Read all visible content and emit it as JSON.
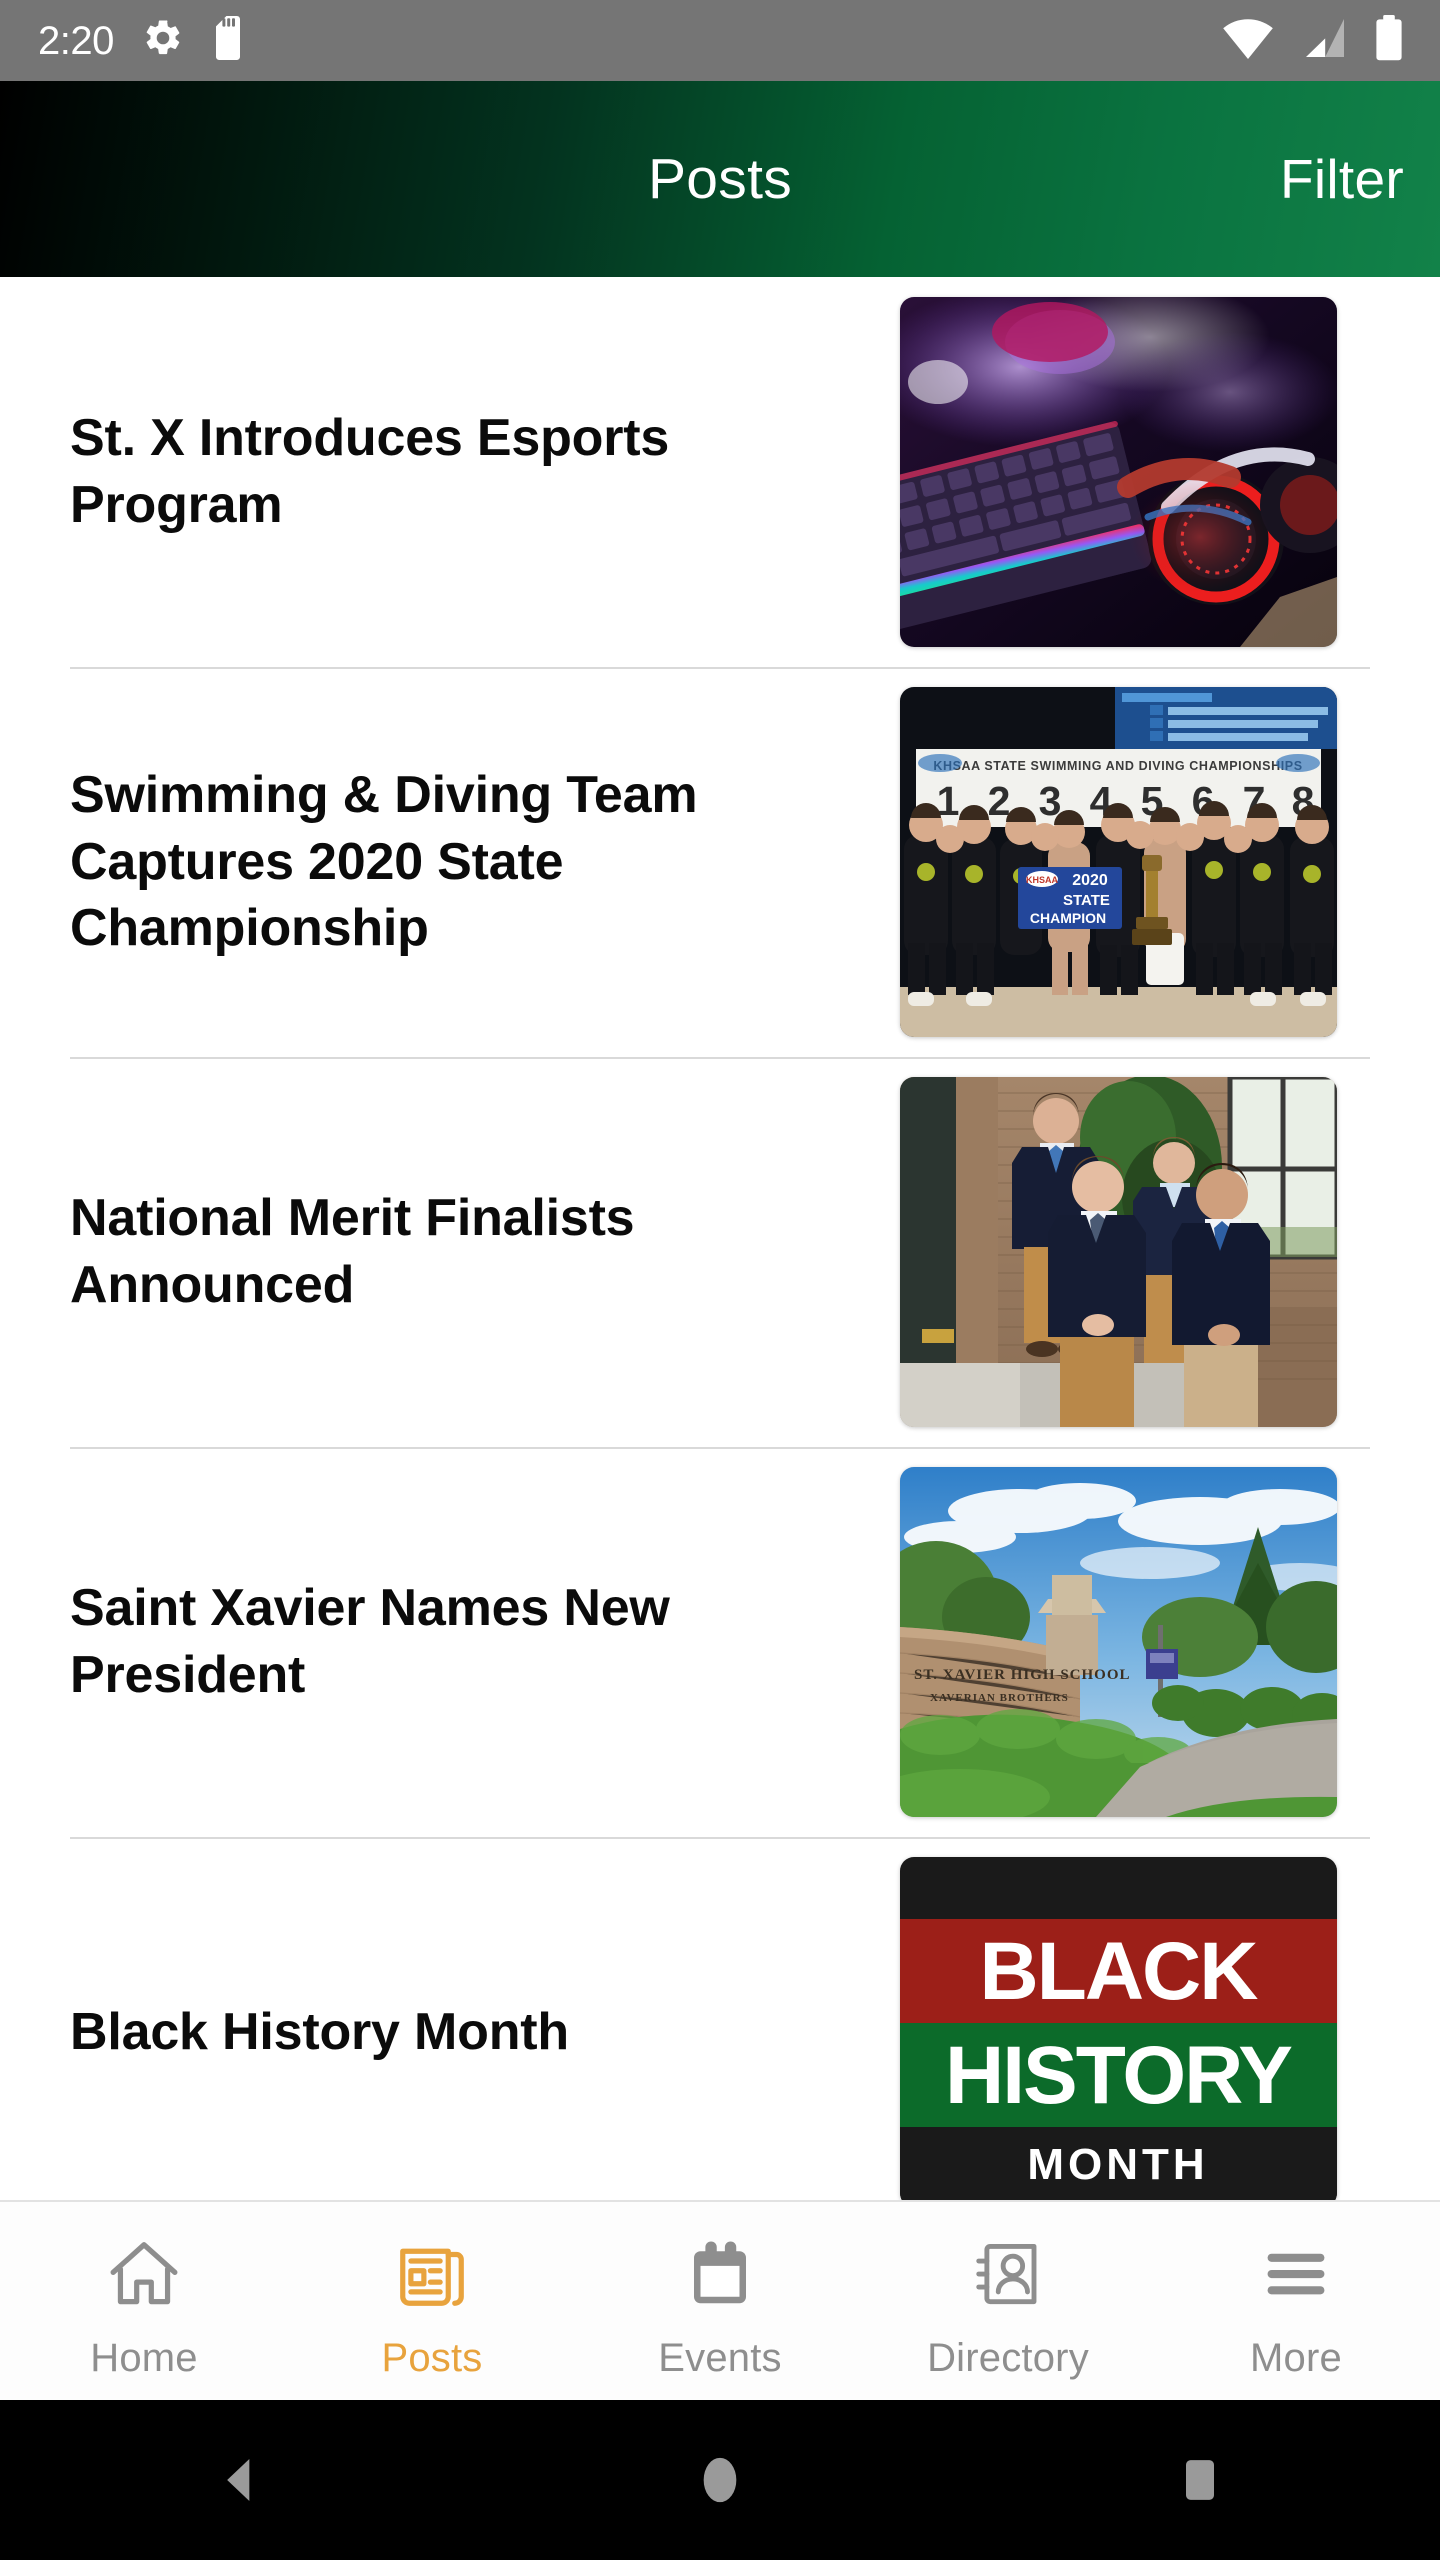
{
  "status_bar": {
    "time": "2:20",
    "icons_left": [
      "settings-gear-icon",
      "sd-card-icon"
    ],
    "icons_right": [
      "wifi-icon",
      "cellular-signal-icon",
      "battery-icon"
    ],
    "background_color": "#757575"
  },
  "header": {
    "title": "Posts",
    "filter_label": "Filter",
    "gradient_from": "#000000",
    "gradient_to": "#128249"
  },
  "posts": [
    {
      "title": "St. X Introduces Esports Program",
      "image_alt": "esports-gaming-keyboard-and-headset"
    },
    {
      "title": "Swimming & Diving Team Captures 2020 State Championship",
      "image_alt": "swim-team-state-champions-group-photo",
      "image_text": [
        "KHSAA STATE SWIMMING AND DIVING CHAMPIONSHIPS",
        "1",
        "2",
        "3",
        "4",
        "5",
        "6",
        "7",
        "8",
        "2020 STATE CHAMPION"
      ]
    },
    {
      "title": "National Merit Finalists Announced",
      "image_alt": "four-students-in-blazers-outside-school"
    },
    {
      "title": "Saint Xavier Names New President",
      "image_alt": "campus-entrance-sign-and-landscaping",
      "image_text": [
        "ST. XAVIER HIGH SCHOOL",
        "XAVERIAN BROTHERS"
      ]
    },
    {
      "title": "Black History Month",
      "image_alt": "black-history-month-banner",
      "image_text": [
        "BLACK",
        "HISTORY"
      ]
    }
  ],
  "tabs": [
    {
      "label": "Home",
      "icon": "home-icon",
      "active": false
    },
    {
      "label": "Posts",
      "icon": "newspaper-icon",
      "active": true
    },
    {
      "label": "Events",
      "icon": "calendar-icon",
      "active": false
    },
    {
      "label": "Directory",
      "icon": "contact-book-icon",
      "active": false
    },
    {
      "label": "More",
      "icon": "hamburger-menu-icon",
      "active": false
    }
  ],
  "tab_colors": {
    "active": "#e8a33d",
    "inactive": "#8e8e8e"
  },
  "android_nav": {
    "buttons": [
      "back-button",
      "home-button",
      "recents-button"
    ],
    "background_color": "#000000",
    "icon_color": "#9a9a9a"
  }
}
